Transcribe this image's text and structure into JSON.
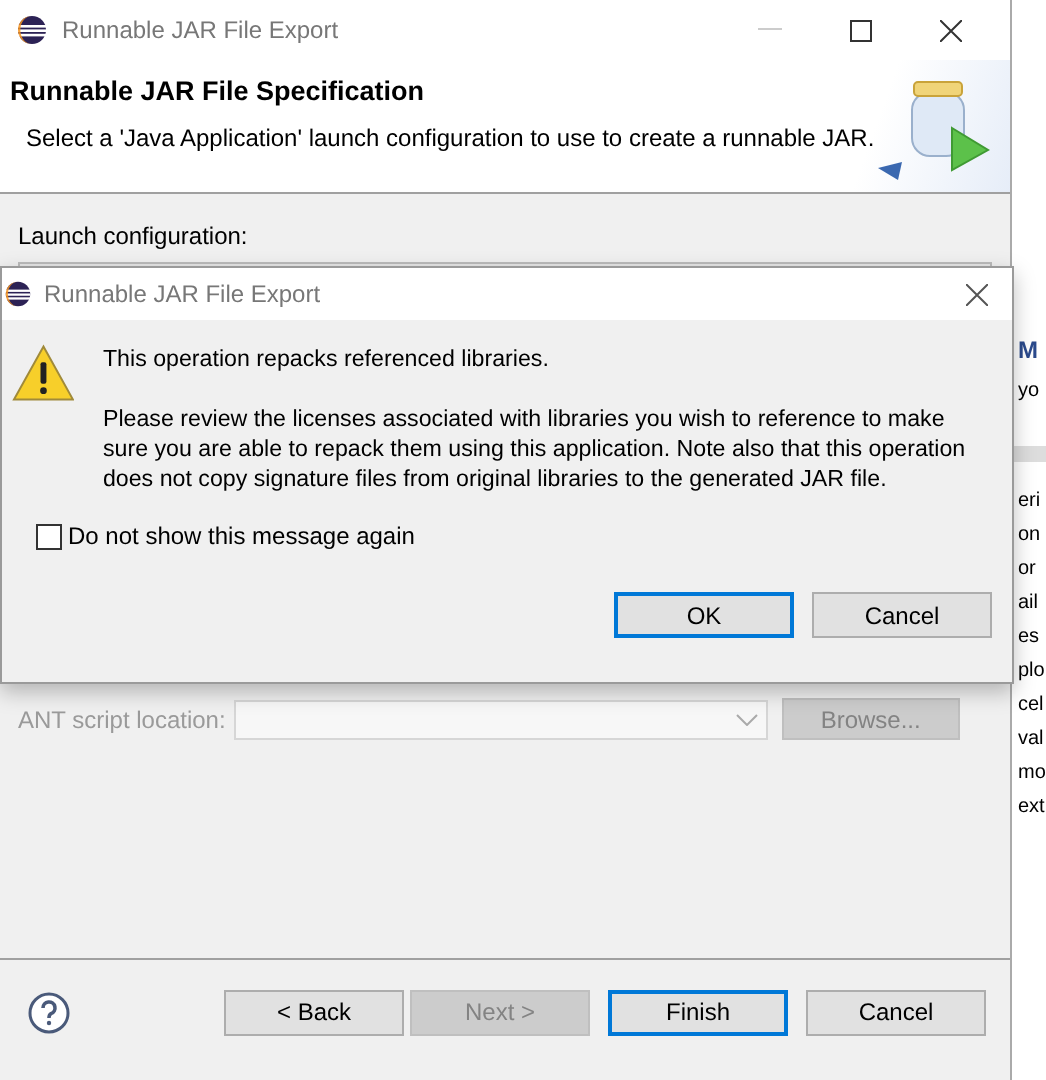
{
  "window": {
    "title": "Runnable JAR File Export"
  },
  "header": {
    "title": "Runnable JAR File Specification",
    "description": "Select a 'Java Application' launch configuration to use to create a runnable JAR."
  },
  "launch_configuration": {
    "label": "Launch configuration:"
  },
  "ant_script": {
    "label": "ANT script location:",
    "disabled": true,
    "browse_button": {
      "label": "Browse...",
      "disabled": true
    }
  },
  "footer_buttons": [
    {
      "label": "< Back",
      "disabled": false,
      "default": false
    },
    {
      "label": "Next >",
      "disabled": true,
      "default": false
    },
    {
      "label": "Finish",
      "disabled": false,
      "default": true
    },
    {
      "label": "Cancel",
      "disabled": false,
      "default": false
    }
  ],
  "dialog": {
    "title": "Runnable JAR File Export",
    "heading": "This operation repacks referenced libraries.",
    "message": "Please review the licenses associated with libraries you wish to reference to make sure you are able to repack them using this application. Note also that this operation does not copy signature files from original libraries to the generated JAR file.",
    "checkbox": {
      "label": "Do not show this message again",
      "checked": false
    },
    "buttons": [
      {
        "label": "OK",
        "default": true
      },
      {
        "label": "Cancel",
        "default": false
      }
    ]
  },
  "background_window": {
    "top_lines": [
      {
        "text": "M",
        "kind": "heading"
      },
      {
        "text": "yo",
        "kind": "text"
      }
    ],
    "lines": [
      "eri",
      "on",
      "or",
      "ail",
      "es",
      "plo",
      "cel",
      "val",
      "mo",
      "ext"
    ]
  }
}
